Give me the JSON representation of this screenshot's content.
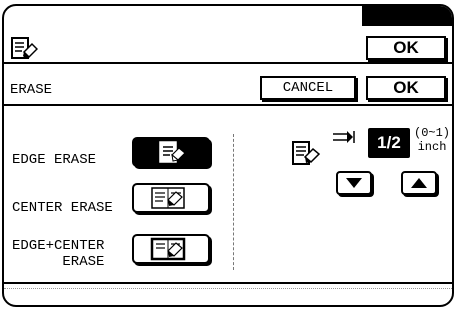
{
  "header": {
    "ok_label": "OK"
  },
  "screen": {
    "title": "ERASE",
    "cancel_label": "CANCEL",
    "ok_label": "OK"
  },
  "options": [
    {
      "label_line1": "EDGE ERASE",
      "label_line2": "",
      "selected": true,
      "icon": "edge-erase-icon"
    },
    {
      "label_line1": "CENTER ERASE",
      "label_line2": "",
      "selected": false,
      "icon": "center-erase-icon"
    },
    {
      "label_line1": "EDGE+CENTER",
      "label_line2": "ERASE",
      "selected": false,
      "icon": "edge-center-erase-icon"
    }
  ],
  "width_setting": {
    "value": "1/2",
    "range_line1": "(0~1)",
    "range_line2": "inch",
    "decrease_icon": "down-arrow-icon",
    "increase_icon": "up-arrow-icon"
  }
}
